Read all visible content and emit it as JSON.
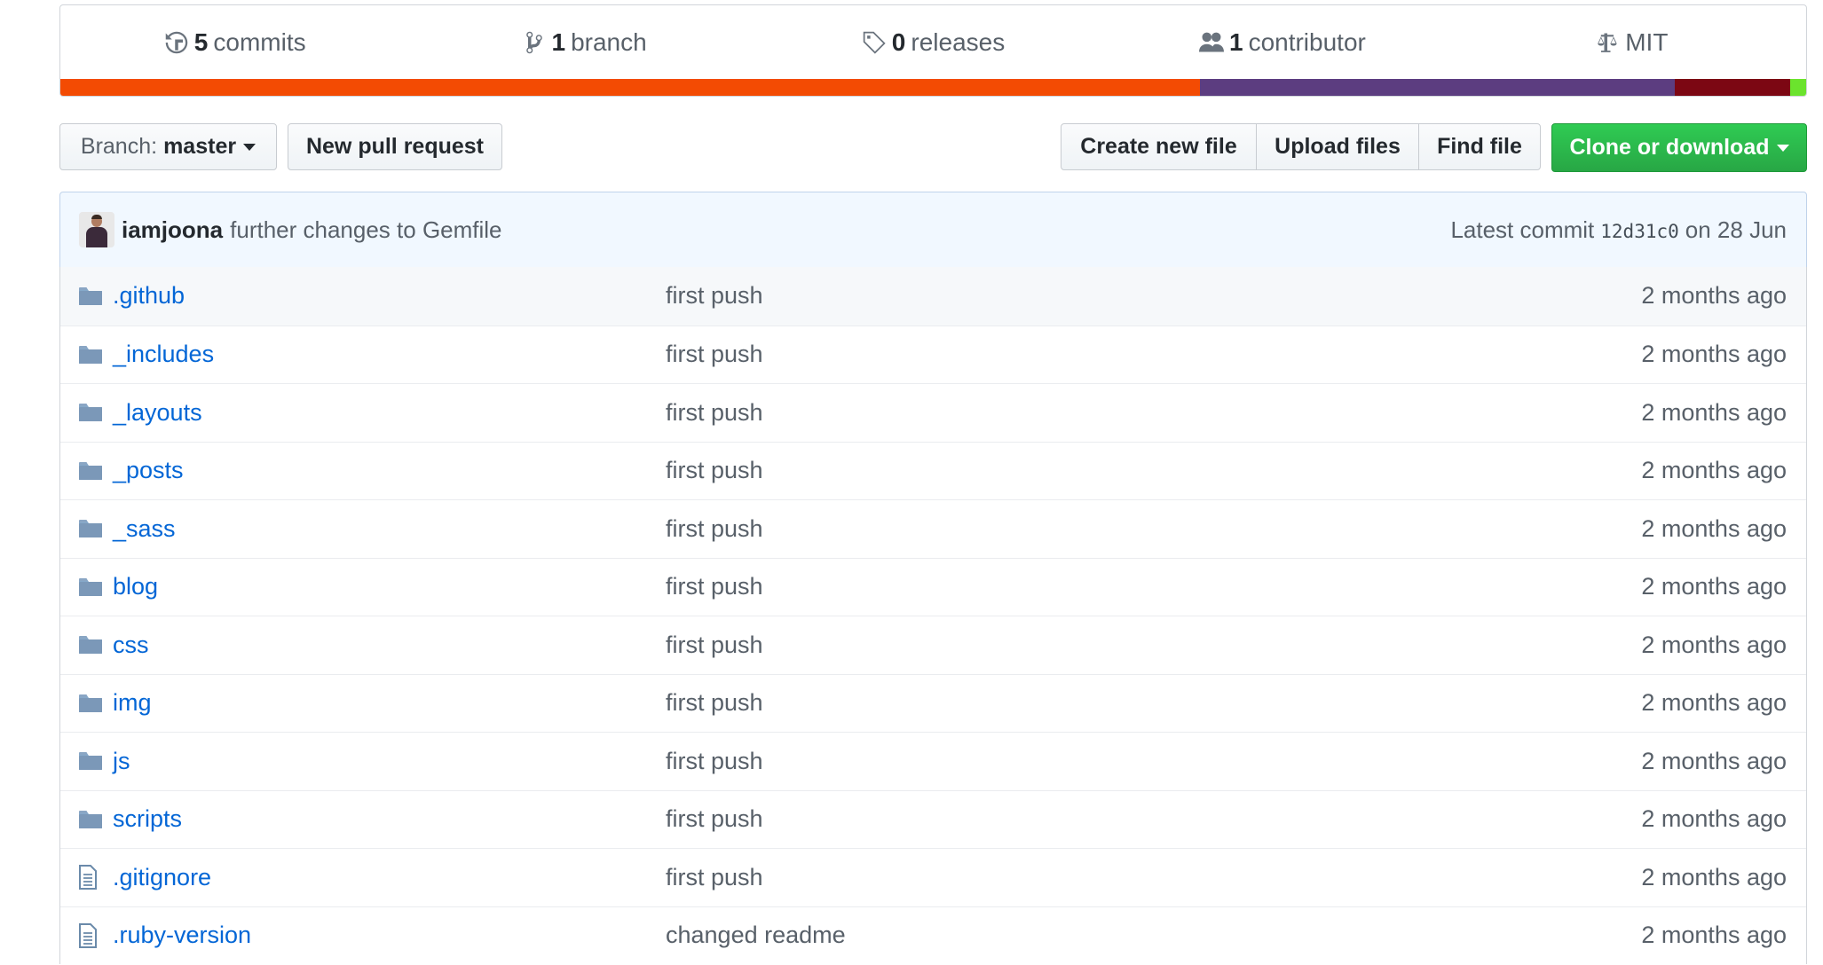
{
  "summary": {
    "stats": [
      {
        "icon": "history-icon",
        "count": "5",
        "label": "commits"
      },
      {
        "icon": "branch-icon",
        "count": "1",
        "label": "branch"
      },
      {
        "icon": "tag-icon",
        "count": "0",
        "label": "releases"
      },
      {
        "icon": "people-icon",
        "count": "1",
        "label": "contributor"
      },
      {
        "icon": "law-icon",
        "count": "",
        "label": "MIT"
      }
    ],
    "languages": [
      {
        "color": "#f34b03",
        "percent": 65.3
      },
      {
        "color": "#5c3d80",
        "percent": 27.2
      },
      {
        "color": "#7c0713",
        "percent": 6.6
      },
      {
        "color": "#6be32d",
        "percent": 0.9
      }
    ]
  },
  "toolbar": {
    "branch_prefix": "Branch:",
    "branch_name": "master",
    "new_pull_request": "New pull request",
    "create_new_file": "Create new file",
    "upload_files": "Upload files",
    "find_file": "Find file",
    "clone_or_download": "Clone or download"
  },
  "latest_commit": {
    "author": "iamjoona",
    "message": "further changes to Gemfile",
    "prefix": "Latest commit",
    "sha": "12d31c0",
    "date": "on 28 Jun"
  },
  "files": [
    {
      "type": "folder",
      "name": ".github",
      "message": "first push",
      "age": "2 months ago"
    },
    {
      "type": "folder",
      "name": "_includes",
      "message": "first push",
      "age": "2 months ago"
    },
    {
      "type": "folder",
      "name": "_layouts",
      "message": "first push",
      "age": "2 months ago"
    },
    {
      "type": "folder",
      "name": "_posts",
      "message": "first push",
      "age": "2 months ago"
    },
    {
      "type": "folder",
      "name": "_sass",
      "message": "first push",
      "age": "2 months ago"
    },
    {
      "type": "folder",
      "name": "blog",
      "message": "first push",
      "age": "2 months ago"
    },
    {
      "type": "folder",
      "name": "css",
      "message": "first push",
      "age": "2 months ago"
    },
    {
      "type": "folder",
      "name": "img",
      "message": "first push",
      "age": "2 months ago"
    },
    {
      "type": "folder",
      "name": "js",
      "message": "first push",
      "age": "2 months ago"
    },
    {
      "type": "folder",
      "name": "scripts",
      "message": "first push",
      "age": "2 months ago"
    },
    {
      "type": "file",
      "name": ".gitignore",
      "message": "first push",
      "age": "2 months ago"
    },
    {
      "type": "file",
      "name": ".ruby-version",
      "message": "changed readme",
      "age": "2 months ago"
    }
  ]
}
